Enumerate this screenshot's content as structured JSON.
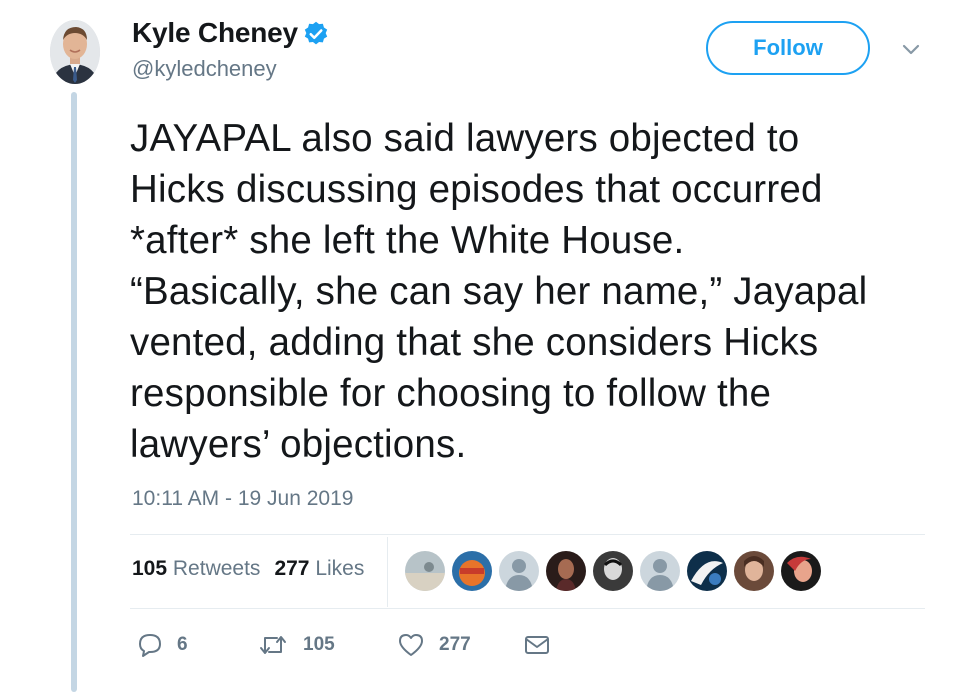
{
  "author": {
    "name": "Kyle Cheney",
    "handle": "@kyledcheney",
    "verified_icon": "verified-badge-icon"
  },
  "header": {
    "follow_label": "Follow",
    "menu_icon": "chevron-down-icon"
  },
  "tweet": {
    "text": "JAYAPAL also said lawyers objected to\nHicks discussing episodes that occurred\n*after* she left the White House.\n“Basically, she can say her name,” Jayapal\nvented, adding that she considers Hicks\nresponsible for choosing to follow the\nlawyers’ objections.",
    "timestamp": "10:11 AM - 19 Jun 2019"
  },
  "stats": {
    "retweets_count": "105",
    "retweets_label": "Retweets",
    "likes_count": "277",
    "likes_label": "Likes"
  },
  "actions": {
    "reply_count": "6",
    "retweet_count": "105",
    "like_count": "277"
  },
  "colors": {
    "accent": "#1da1f2",
    "muted": "#657786",
    "thread_line": "#c4d6e4"
  }
}
